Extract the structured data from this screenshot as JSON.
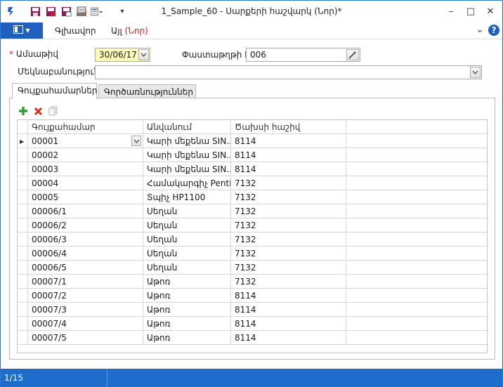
{
  "window": {
    "title": "1_Sample_60 - Սարքերի հաշվարկ (Նոր)*",
    "min": "–",
    "max": "□",
    "close": "✕"
  },
  "menu": {
    "main_icon": "panel-menu-icon",
    "items": [
      {
        "label": "Գլխավոր"
      },
      {
        "label_prefix": "Այլ ",
        "label_accent": "(Նոր)"
      }
    ],
    "collapse": "⌄",
    "help": "?"
  },
  "form": {
    "date_label": "Ամսաթիվ",
    "date_value": "30/06/17",
    "doc_no_label": "Փաստաթղթի N",
    "doc_no_value": "006",
    "comment_label": "Մեկնաբանություն",
    "comment_value": ""
  },
  "tabs": [
    {
      "label": "Գույքահամարներ",
      "active": true
    },
    {
      "label": "Գործառնություններ",
      "active": false
    }
  ],
  "grid": {
    "columns": [
      "Գույքահամար",
      "Անվանում",
      "Ծախսի հաշիվ",
      ""
    ],
    "rows": [
      {
        "code": "00001",
        "name": "Կարի մեքենա SIN...",
        "account": "8114"
      },
      {
        "code": "00002",
        "name": "Կարի մեքենա SIN...",
        "account": "8114"
      },
      {
        "code": "00003",
        "name": "Կարի մեքենա SIN...",
        "account": "8114"
      },
      {
        "code": "00004",
        "name": "Համակարգիչ Penti...",
        "account": "7132"
      },
      {
        "code": "00005",
        "name": "Տպիչ HP1100",
        "account": "7132"
      },
      {
        "code": "00006/1",
        "name": "Սեղան",
        "account": "7132"
      },
      {
        "code": "00006/2",
        "name": "Սեղան",
        "account": "7132"
      },
      {
        "code": "00006/3",
        "name": "Սեղան",
        "account": "7132"
      },
      {
        "code": "00006/4",
        "name": "Սեղան",
        "account": "7132"
      },
      {
        "code": "00006/5",
        "name": "Սեղան",
        "account": "7132"
      },
      {
        "code": "00007/1",
        "name": "Աթոռ",
        "account": "7132"
      },
      {
        "code": "00007/2",
        "name": "Աթոռ",
        "account": "8114"
      },
      {
        "code": "00007/3",
        "name": "Աթոռ",
        "account": "8114"
      },
      {
        "code": "00007/4",
        "name": "Աթոռ",
        "account": "8114"
      },
      {
        "code": "00007/5",
        "name": "Աթոռ",
        "account": "8114"
      }
    ]
  },
  "status": {
    "record": "1/15"
  },
  "colors": {
    "accent": "#1e5fbf",
    "status_bg": "#1e6dcc",
    "date_highlight": "#fff9b8",
    "add_green": "#2e9e3a",
    "delete_red": "#d9311f"
  }
}
